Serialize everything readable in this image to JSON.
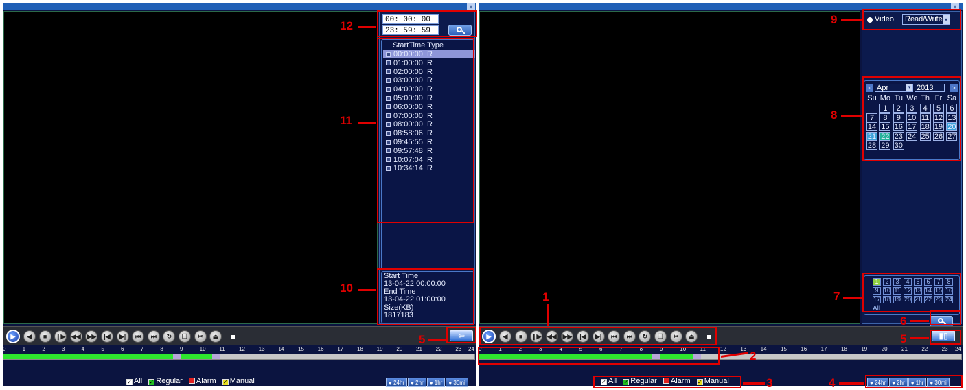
{
  "left_panel": {
    "close_glyph": "x",
    "search_start_time": "00: 00: 00",
    "search_end_time": "23: 59: 59",
    "file_list_header": "StartTime Type",
    "files": [
      {
        "time": "00:00:00",
        "type": "R"
      },
      {
        "time": "01:00:00",
        "type": "R"
      },
      {
        "time": "02:00:00",
        "type": "R"
      },
      {
        "time": "03:00:00",
        "type": "R"
      },
      {
        "time": "04:00:00",
        "type": "R"
      },
      {
        "time": "05:00:00",
        "type": "R"
      },
      {
        "time": "06:00:00",
        "type": "R"
      },
      {
        "time": "07:00:00",
        "type": "R"
      },
      {
        "time": "08:00:00",
        "type": "R"
      },
      {
        "time": "08:58:06",
        "type": "R"
      },
      {
        "time": "09:45:55",
        "type": "R"
      },
      {
        "time": "09:57:48",
        "type": "R"
      },
      {
        "time": "10:07:04",
        "type": "R"
      },
      {
        "time": "10:34:14",
        "type": "R"
      }
    ],
    "file_info": {
      "start_label": "Start Time",
      "start_value": "13-04-22 00:00:00",
      "end_label": "End Time",
      "end_value": "13-04-22 01:00:00",
      "size_label": "Size(KB)",
      "size_value": "1817183"
    },
    "back_glyph": "⇦"
  },
  "right_panel": {
    "close_glyph": "x",
    "video_radio_label": "Video",
    "mode_select_value": "Read/Write",
    "calendar": {
      "month": "Apr",
      "year": "2013",
      "weekdays": [
        "Su",
        "Mo",
        "Tu",
        "We",
        "Th",
        "Fr",
        "Sa"
      ],
      "days": [
        "1",
        "2",
        "3",
        "4",
        "5",
        "6",
        "7",
        "8",
        "9",
        "10",
        "11",
        "12",
        "13",
        "14",
        "15",
        "16",
        "17",
        "18",
        "19",
        "20",
        "21",
        "22",
        "23",
        "24",
        "25",
        "26",
        "27",
        "28",
        "29",
        "30"
      ],
      "first_weekday_index": 1,
      "boxed_days": [
        "1",
        "2",
        "3",
        "4",
        "5",
        "6",
        "7",
        "8",
        "9",
        "10",
        "11",
        "12",
        "13",
        "14",
        "15",
        "16",
        "17",
        "18",
        "19",
        "20",
        "21",
        "22",
        "23",
        "24",
        "25",
        "26",
        "27",
        "28",
        "29",
        "30"
      ],
      "highlight_blue": [
        "20",
        "21"
      ],
      "highlight_teal": [
        "22"
      ]
    },
    "channels": [
      "1",
      "2",
      "3",
      "4",
      "5",
      "6",
      "7",
      "8",
      "9",
      "10",
      "11",
      "12",
      "13",
      "14",
      "15",
      "16",
      "17",
      "18",
      "19",
      "20",
      "21",
      "22",
      "23",
      "24"
    ],
    "channel_selected": "1",
    "channels_all_label": "All"
  },
  "timeline": {
    "ticks": [
      "0",
      "1",
      "2",
      "3",
      "4",
      "5",
      "6",
      "7",
      "8",
      "9",
      "10",
      "11",
      "12",
      "13",
      "14",
      "15",
      "16",
      "17",
      "18",
      "19",
      "20",
      "21",
      "22",
      "23",
      "24"
    ],
    "left_segments": [
      {
        "start": 0,
        "end": 8.6,
        "color": "#2ee62e"
      },
      {
        "start": 8.6,
        "end": 9.0,
        "color": "#b7a6d8"
      },
      {
        "start": 9.0,
        "end": 10.6,
        "color": "#2ee62e"
      },
      {
        "start": 10.6,
        "end": 11.0,
        "color": "#b7a6d8"
      }
    ],
    "right_segments": [
      {
        "start": 0,
        "end": 8.6,
        "color": "#2ee62e"
      },
      {
        "start": 8.6,
        "end": 9.0,
        "color": "#b7a6d8"
      },
      {
        "start": 9.0,
        "end": 10.6,
        "color": "#2ee62e"
      },
      {
        "start": 10.6,
        "end": 11.0,
        "color": "#b7a6d8"
      }
    ]
  },
  "legend": {
    "all": "All",
    "regular": "Regular",
    "alarm": "Alarm",
    "manual": "Manual",
    "regular_color": "#22c022",
    "alarm_color": "#e02020",
    "manual_color": "#e8e020"
  },
  "zoom_buttons": [
    "24hr",
    "2hr",
    "1hr",
    "30mi"
  ],
  "playback_buttons": [
    {
      "name": "play",
      "glyph": "▶"
    },
    {
      "name": "reverse-play",
      "glyph": "◀"
    },
    {
      "name": "stop",
      "glyph": "■"
    },
    {
      "name": "step-back",
      "glyph": "❙▶"
    },
    {
      "name": "fast-reverse",
      "glyph": "◀◀"
    },
    {
      "name": "fast-forward",
      "glyph": "▶▶"
    },
    {
      "name": "previous-frame",
      "glyph": "|◀"
    },
    {
      "name": "next-frame",
      "glyph": "▶|"
    },
    {
      "name": "previous-file",
      "glyph": "⏮"
    },
    {
      "name": "next-file",
      "glyph": "⏭"
    },
    {
      "name": "loop",
      "glyph": "↻"
    },
    {
      "name": "fullscreen",
      "glyph": "❐"
    },
    {
      "name": "clip",
      "glyph": "✂"
    },
    {
      "name": "backup",
      "glyph": "⏏"
    }
  ],
  "callouts": {
    "c1": "1",
    "c2": "2",
    "c3": "3",
    "c4": "4",
    "c5a": "5",
    "c5b": "5",
    "c6": "6",
    "c7": "7",
    "c8": "8",
    "c9": "9",
    "c10": "10",
    "c11": "11",
    "c12": "12"
  }
}
